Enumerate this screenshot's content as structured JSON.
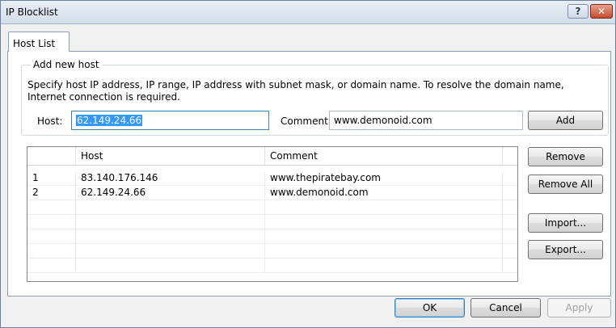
{
  "window": {
    "title": "IP Blocklist",
    "help_glyph": "?",
    "close_glyph": "✕"
  },
  "tabs": [
    {
      "label": "Host List",
      "selected": true
    }
  ],
  "add_group": {
    "legend": "Add new host",
    "description": "Specify host IP address, IP range, IP address with subnet mask, or domain name. To resolve the domain name, Internet connection is required.",
    "host_label": "Host:",
    "host_value": "62.149.24.66",
    "comment_label": "Comment:",
    "comment_value": "www.demonoid.com",
    "add_button": "Add"
  },
  "table": {
    "columns": [
      "",
      "Host",
      "Comment"
    ],
    "rows": [
      {
        "index": "1",
        "host": "83.140.176.146",
        "comment": "www.thepiratebay.com"
      },
      {
        "index": "2",
        "host": "62.149.24.66",
        "comment": "www.demonoid.com"
      }
    ]
  },
  "side_buttons": {
    "remove": "Remove",
    "remove_all": "Remove All",
    "import": "Import...",
    "export": "Export..."
  },
  "footer": {
    "ok": "OK",
    "cancel": "Cancel",
    "apply": "Apply"
  },
  "colors": {
    "selection": "#3399ff",
    "focus_border": "#3c7fb1",
    "title_gradient_top": "#e9eef6"
  }
}
